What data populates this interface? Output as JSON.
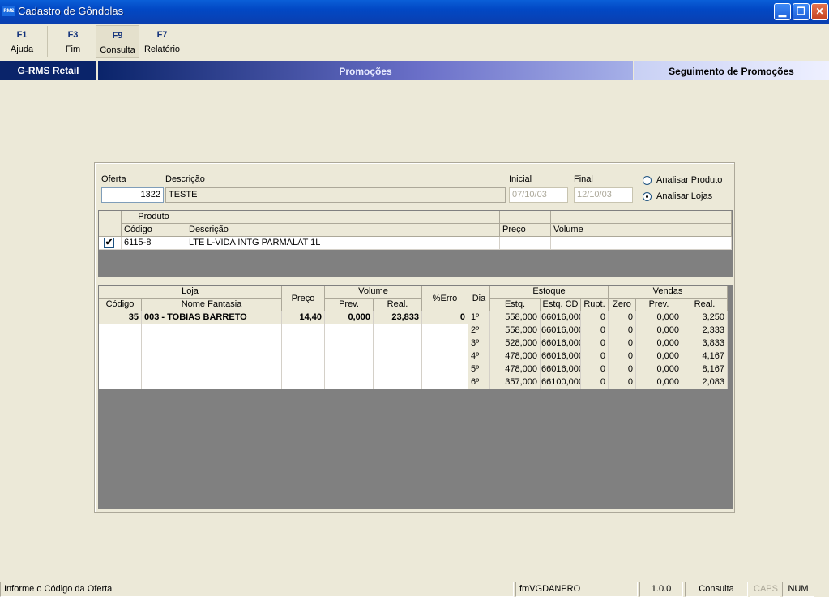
{
  "window": {
    "logo_text": "RMS",
    "title": "Cadastro de Gôndolas",
    "min": "▁",
    "max": "❐",
    "close": "✕"
  },
  "toolbar": [
    {
      "key": "F1",
      "label": "Ajuda"
    },
    {
      "key": "F3",
      "label": "Fim"
    },
    {
      "key": "F9",
      "label": "Consulta"
    },
    {
      "key": "F7",
      "label": "Relatório"
    }
  ],
  "banner": {
    "left": "G-RMS Retail",
    "center": "Promoções",
    "right": "Seguimento de Promoções"
  },
  "form": {
    "oferta_label": "Oferta",
    "oferta_value": "1322",
    "descricao_label": "Descrição",
    "descricao_value": "TESTE",
    "inicial_label": "Inicial",
    "inicial_value": "07/10/03",
    "final_label": "Final",
    "final_value": "12/10/03",
    "radio_produto": "Analisar Produto",
    "radio_lojas": "Analisar Lojas",
    "selected_radio": "lojas"
  },
  "product_grid": {
    "group_header": "Produto",
    "headers": {
      "codigo": "Código",
      "descricao": "Descrição",
      "preco": "Preço",
      "volume": "Volume"
    },
    "rows": [
      {
        "checked": true,
        "check_mark": "✔",
        "codigo": "6115-8",
        "descricao": "LTE L-VIDA INTG PARMALAT 1L",
        "preco": "",
        "volume": ""
      }
    ]
  },
  "store_grid": {
    "group_headers": {
      "loja": "Loja",
      "preco": "Preço",
      "volume": "Volume",
      "erro": "%Erro",
      "dia": "Dia",
      "estoque": "Estoque",
      "vendas": "Vendas"
    },
    "sub_headers": {
      "codigo": "Código",
      "nome": "Nome Fantasia",
      "prev": "Prev.",
      "real": "Real.",
      "estq": "Estq.",
      "estq_cd": "Estq. CD",
      "rupt": "Rupt.",
      "zero": "Zero",
      "v_prev": "Prev.",
      "v_real": "Real."
    },
    "rows": [
      {
        "codigo": "35",
        "nome": "003 - TOBIAS BARRETO",
        "preco": "14,40",
        "prev": "0,000",
        "real": "23,833",
        "erro": "0",
        "dia": "1º",
        "estq": "558,000",
        "estq_cd": "66016,000",
        "rupt": "0",
        "zero": "0",
        "v_prev": "0,000",
        "v_real": "3,250"
      },
      {
        "codigo": "",
        "nome": "",
        "preco": "",
        "prev": "",
        "real": "",
        "erro": "",
        "dia": "2º",
        "estq": "558,000",
        "estq_cd": "66016,000",
        "rupt": "0",
        "zero": "0",
        "v_prev": "0,000",
        "v_real": "2,333"
      },
      {
        "codigo": "",
        "nome": "",
        "preco": "",
        "prev": "",
        "real": "",
        "erro": "",
        "dia": "3º",
        "estq": "528,000",
        "estq_cd": "66016,000",
        "rupt": "0",
        "zero": "0",
        "v_prev": "0,000",
        "v_real": "3,833"
      },
      {
        "codigo": "",
        "nome": "",
        "preco": "",
        "prev": "",
        "real": "",
        "erro": "",
        "dia": "4º",
        "estq": "478,000",
        "estq_cd": "66016,000",
        "rupt": "0",
        "zero": "0",
        "v_prev": "0,000",
        "v_real": "4,167"
      },
      {
        "codigo": "",
        "nome": "",
        "preco": "",
        "prev": "",
        "real": "",
        "erro": "",
        "dia": "5º",
        "estq": "478,000",
        "estq_cd": "66016,000",
        "rupt": "0",
        "zero": "0",
        "v_prev": "0,000",
        "v_real": "8,167"
      },
      {
        "codigo": "",
        "nome": "",
        "preco": "",
        "prev": "",
        "real": "",
        "erro": "",
        "dia": "6º",
        "estq": "357,000",
        "estq_cd": "66100,000",
        "rupt": "0",
        "zero": "0",
        "v_prev": "0,000",
        "v_real": "2,083"
      }
    ]
  },
  "status": {
    "message": "Informe o Código da Oferta",
    "form": "fmVGDANPRO",
    "version": "1.0.0",
    "mode": "Consulta",
    "caps": "CAPS",
    "num": "NUM"
  }
}
